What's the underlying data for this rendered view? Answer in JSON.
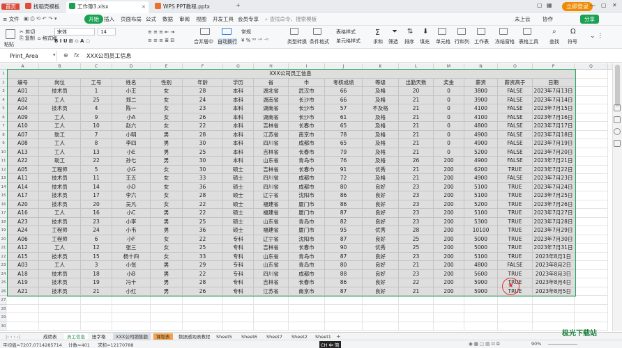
{
  "titlebar": {
    "tabs": [
      {
        "label": "首页",
        "icon": "home"
      },
      {
        "label": "找稻壳模板",
        "icon": "daoke"
      },
      {
        "label": "工作簿3.xlsx",
        "icon": "sheet"
      },
      {
        "label": "WPS PPT教程.pptx",
        "icon": "ppt"
      }
    ],
    "add": "+",
    "login": "立即登录"
  },
  "menubar": {
    "file": "≡ 文件",
    "items": [
      "开始",
      "插入",
      "页面布局",
      "公式",
      "数据",
      "审阅",
      "视图",
      "开发工具",
      "会员专享"
    ],
    "search": "查找命令、搜索模板",
    "cloud": "未上云",
    "collab": "协作",
    "share": "分享"
  },
  "ribbon": {
    "paste": "粘贴",
    "cut": "剪切",
    "copy": "复制",
    "format_painter": "格式刷",
    "font": "宋体",
    "size": "14",
    "merge": "合并居中",
    "wrap": "自动换行",
    "number_format": "常规",
    "cond": "条件格式",
    "table_style": "表格样式",
    "cell_style": "单元格样式",
    "sum": "求和",
    "filter": "筛选",
    "sort": "排序",
    "fill": "填充",
    "cell": "单元格",
    "rowcol": "行和列",
    "worksheet": "工作表",
    "freeze": "冻结窗格",
    "tools": "表格工具",
    "find": "查找",
    "symbol": "符号"
  },
  "formulabar": {
    "name": "Print_Area",
    "fx": "fx",
    "content": "XXX公司员工信息"
  },
  "columns": [
    "A",
    "B",
    "C",
    "D",
    "E",
    "F",
    "G",
    "H",
    "I",
    "J",
    "K",
    "L",
    "M",
    "N",
    "O",
    "P",
    "Q"
  ],
  "table": {
    "title": "XXX公司员工信息",
    "headers": [
      "编号",
      "岗位",
      "工号",
      "姓名",
      "性别",
      "年龄",
      "学历",
      "省",
      "市",
      "考核成绩",
      "等级",
      "出勤天数",
      "奖金",
      "薪资",
      "薪资高于",
      "日期"
    ],
    "rows": [
      [
        "A01",
        "技术员",
        "1",
        "小王",
        "女",
        "28",
        "本科",
        "湖北省",
        "武汉市",
        "66",
        "及格",
        "20",
        "0",
        "3800",
        "FALSE",
        "2023年7月13日"
      ],
      [
        "A02",
        "工人",
        "25",
        "郑二",
        "女",
        "24",
        "本科",
        "湖南省",
        "长沙市",
        "66",
        "及格",
        "21",
        "0",
        "3900",
        "FALSE",
        "2023年7月14日"
      ],
      [
        "A04",
        "技术员",
        "4",
        "陈一",
        "女",
        "23",
        "本科",
        "湖南省",
        "长沙市",
        "57",
        "不及格",
        "21",
        "0",
        "4100",
        "FALSE",
        "2023年7月15日"
      ],
      [
        "A09",
        "工人",
        "9",
        "小A",
        "女",
        "26",
        "本科",
        "湖南省",
        "长沙市",
        "61",
        "及格",
        "21",
        "0",
        "4100",
        "FALSE",
        "2023年7月16日"
      ],
      [
        "A10",
        "工人",
        "10",
        "赵六",
        "女",
        "22",
        "本科",
        "吉林省",
        "长春市",
        "65",
        "及格",
        "21",
        "0",
        "4800",
        "FALSE",
        "2023年7月17日"
      ],
      [
        "A07",
        "助工",
        "7",
        "小明",
        "男",
        "28",
        "本科",
        "江苏省",
        "南京市",
        "78",
        "及格",
        "21",
        "0",
        "4900",
        "FALSE",
        "2023年7月18日"
      ],
      [
        "A08",
        "工人",
        "8",
        "李四",
        "男",
        "30",
        "本科",
        "四川省",
        "成都市",
        "65",
        "及格",
        "21",
        "0",
        "4900",
        "FALSE",
        "2023年7月19日"
      ],
      [
        "A13",
        "工人",
        "13",
        "小E",
        "男",
        "25",
        "本科",
        "吉林省",
        "长春市",
        "79",
        "及格",
        "21",
        "0",
        "5200",
        "FALSE",
        "2023年7月20日"
      ],
      [
        "A22",
        "助工",
        "22",
        "孙七",
        "男",
        "30",
        "本科",
        "山东省",
        "青岛市",
        "76",
        "及格",
        "26",
        "200",
        "4900",
        "FALSE",
        "2023年7月21日"
      ],
      [
        "A05",
        "工程师",
        "5",
        "小G",
        "女",
        "30",
        "硕士",
        "吉林省",
        "长春市",
        "91",
        "优秀",
        "21",
        "200",
        "6200",
        "TRUE",
        "2023年7月22日"
      ],
      [
        "A11",
        "技术员",
        "11",
        "王五",
        "女",
        "33",
        "硕士",
        "四川省",
        "成都市",
        "72",
        "及格",
        "21",
        "200",
        "4900",
        "FALSE",
        "2023年7月23日"
      ],
      [
        "A14",
        "技术员",
        "14",
        "小D",
        "女",
        "36",
        "硕士",
        "四川省",
        "成都市",
        "80",
        "良好",
        "23",
        "200",
        "5100",
        "TRUE",
        "2023年7月24日"
      ],
      [
        "A17",
        "技术员",
        "17",
        "李六",
        "女",
        "28",
        "硕士",
        "辽宁省",
        "沈阳市",
        "86",
        "良好",
        "23",
        "200",
        "5100",
        "TRUE",
        "2023年7月25日"
      ],
      [
        "A20",
        "技术员",
        "20",
        "吴凡",
        "女",
        "22",
        "硕士",
        "福建省",
        "厦门市",
        "86",
        "良好",
        "23",
        "200",
        "5200",
        "TRUE",
        "2023年7月26日"
      ],
      [
        "A16",
        "工人",
        "16",
        "小C",
        "男",
        "22",
        "硕士",
        "福建省",
        "厦门市",
        "87",
        "良好",
        "23",
        "200",
        "5100",
        "TRUE",
        "2023年7月27日"
      ],
      [
        "A23",
        "技术员",
        "23",
        "小李",
        "男",
        "25",
        "硕士",
        "山东省",
        "青岛市",
        "82",
        "良好",
        "23",
        "200",
        "5300",
        "TRUE",
        "2023年7月28日"
      ],
      [
        "A24",
        "工程师",
        "24",
        "小韦",
        "男",
        "36",
        "硕士",
        "福建省",
        "厦门市",
        "95",
        "优秀",
        "28",
        "200",
        "10100",
        "TRUE",
        "2023年7月29日"
      ],
      [
        "A06",
        "工程师",
        "6",
        "小F",
        "女",
        "22",
        "专科",
        "辽宁省",
        "沈阳市",
        "87",
        "良好",
        "25",
        "200",
        "5000",
        "TRUE",
        "2023年7月30日"
      ],
      [
        "A12",
        "工人",
        "12",
        "张三",
        "女",
        "25",
        "专科",
        "吉林省",
        "长春市",
        "90",
        "优秀",
        "25",
        "200",
        "5000",
        "TRUE",
        "2023年7月31日"
      ],
      [
        "A15",
        "技术员",
        "15",
        "杨十四",
        "女",
        "33",
        "专科",
        "山东省",
        "青岛市",
        "87",
        "良好",
        "23",
        "200",
        "5100",
        "TRUE",
        "2023年8月1日"
      ],
      [
        "A03",
        "工人",
        "3",
        "小张",
        "男",
        "29",
        "专科",
        "山东省",
        "青岛市",
        "80",
        "良好",
        "21",
        "200",
        "4800",
        "FALSE",
        "2023年8月2日"
      ],
      [
        "A18",
        "技术员",
        "18",
        "小B",
        "男",
        "22",
        "专科",
        "四川省",
        "成都市",
        "88",
        "良好",
        "23",
        "200",
        "5600",
        "TRUE",
        "2023年8月3日"
      ],
      [
        "A19",
        "技术员",
        "19",
        "冯十",
        "男",
        "28",
        "专科",
        "吉林省",
        "长春市",
        "86",
        "良好",
        "22",
        "200",
        "5900",
        "TRUE",
        "2023年8月4日"
      ],
      [
        "A21",
        "技术员",
        "21",
        "小红",
        "男",
        "26",
        "专科",
        "江苏省",
        "南京市",
        "87",
        "良好",
        "21",
        "200",
        "5900",
        "TRUE",
        "2023年8月5日"
      ]
    ]
  },
  "sheets": [
    "成绩表",
    "员工信息",
    "田字格",
    "XXX公司销售额",
    "课程表",
    "数据透视表教程",
    "Sheet5",
    "Sheet6",
    "Sheet7",
    "Sheet2",
    "Sheet1"
  ],
  "active_sheet": 1,
  "status": {
    "average": "平均值=7207.07142857​14",
    "count": "计数=401",
    "sum": "求和=1217​0788",
    "ime": "CH 中 简",
    "zoom": "90%"
  },
  "watermark": "极光下载站"
}
